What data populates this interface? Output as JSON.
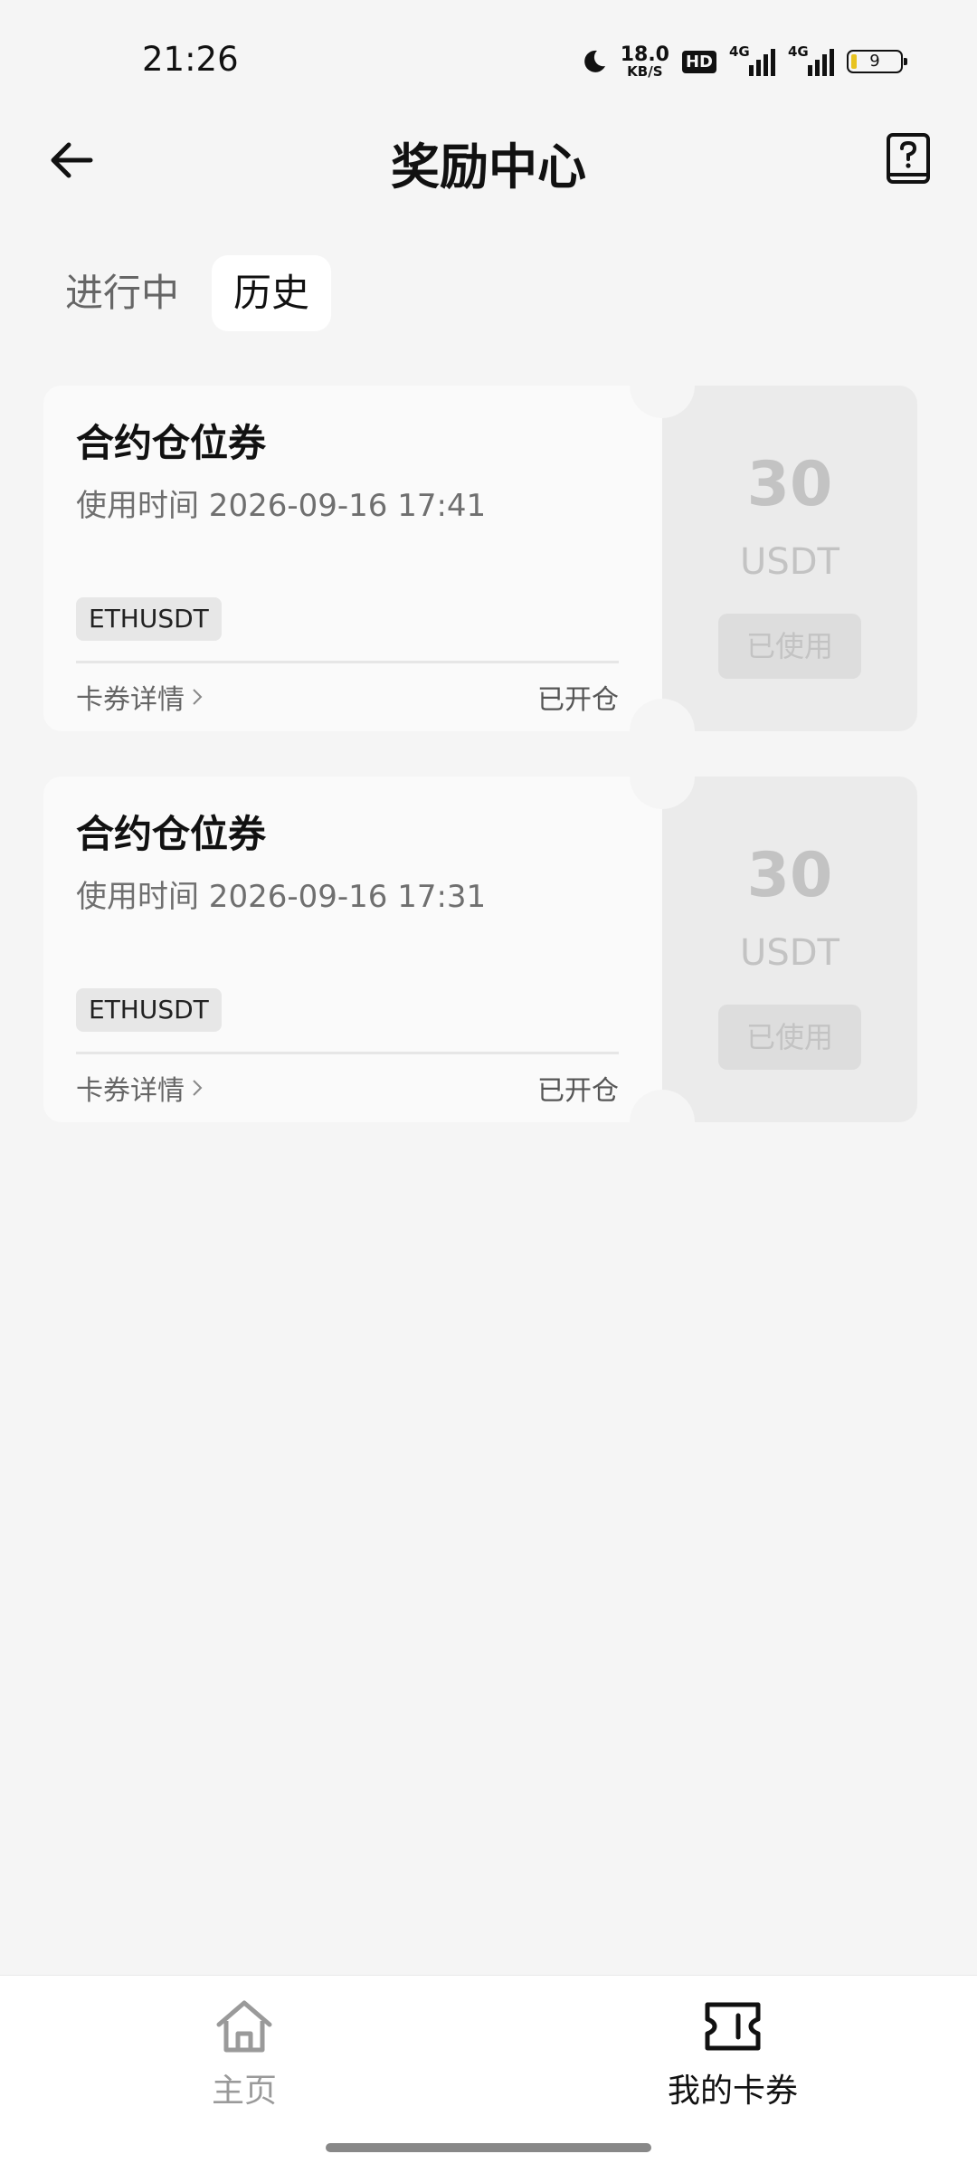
{
  "status_bar": {
    "time": "21:26",
    "net_speed": "18.0",
    "net_unit": "KB/S",
    "hd": "HD",
    "signal1": "4G",
    "signal2": "4G",
    "battery": "9"
  },
  "header": {
    "title": "奖励中心",
    "back_icon": "arrow-left-icon",
    "help_icon": "help-book-icon"
  },
  "tabs": [
    {
      "label": "进行中",
      "active": false
    },
    {
      "label": "历史",
      "active": true
    }
  ],
  "coupons": [
    {
      "title": "合约仓位券",
      "time": "使用时间 2026-09-16 17:41",
      "tag": "ETHUSDT",
      "detail": "卡券详情",
      "status": "已开仓",
      "amount": "30",
      "unit": "USDT",
      "badge": "已使用"
    },
    {
      "title": "合约仓位券",
      "time": "使用时间 2026-09-16 17:31",
      "tag": "ETHUSDT",
      "detail": "卡券详情",
      "status": "已开仓",
      "amount": "30",
      "unit": "USDT",
      "badge": "已使用"
    }
  ],
  "bottom_nav": [
    {
      "label": "主页",
      "icon": "home-icon",
      "active": false
    },
    {
      "label": "我的卡券",
      "icon": "ticket-icon",
      "active": true
    }
  ]
}
